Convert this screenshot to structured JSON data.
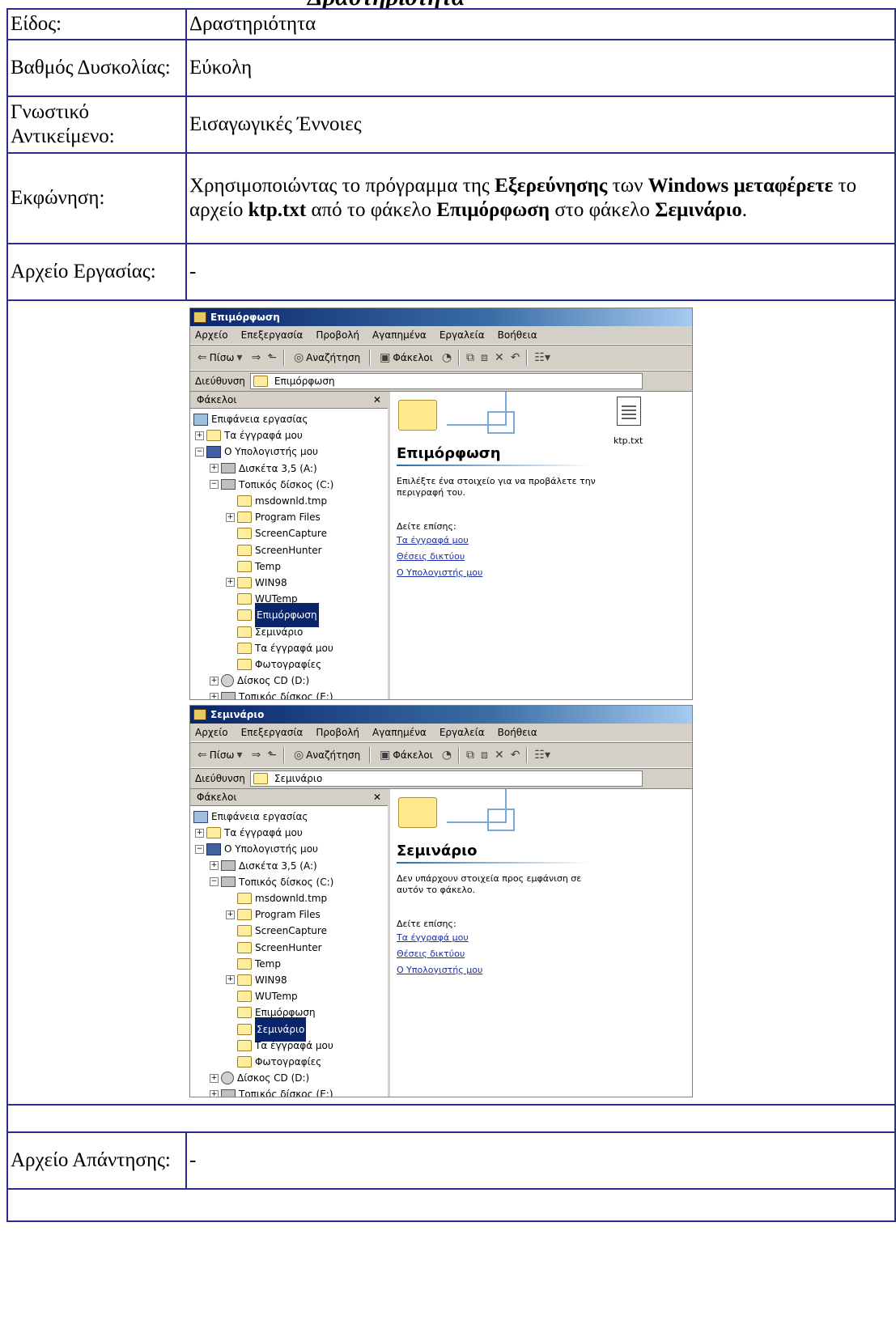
{
  "heading_cut": "Δραστηριότητα",
  "rows": [
    {
      "label": "Είδος:",
      "value": "Δραστηριότητα"
    },
    {
      "label": "Βαθμός Δυσκολίας:",
      "value": "Εύκολη"
    },
    {
      "label": "Γνωστικό Αντικείμενο:",
      "value": "Εισαγωγικές Έννοιες"
    }
  ],
  "task": {
    "label": "Εκφώνηση:",
    "p1": "Χρησιμοποιώντας το πρόγραμμα της ",
    "b1": "Εξερεύνησης",
    "p2": " των ",
    "b2": "Windows",
    "p3": " ",
    "b3": "μεταφέρετε",
    "p4": " το αρχείο ",
    "b4": "ktp.txt",
    "p5": " από το φάκελο ",
    "b5": "Επιμόρφωση",
    "p6": " στο φάκελο ",
    "b6": "Σεμινάριο",
    "p7": "."
  },
  "work_file": {
    "label": "Αρχείο Εργασίας:",
    "value": "-"
  },
  "answer_file": {
    "label": "Αρχείο Απάντησης:",
    "value": "-"
  },
  "windows": [
    {
      "title": "Επιμόρφωση",
      "menu": [
        "Αρχείο",
        "Επεξεργασία",
        "Προβολή",
        "Αγαπημένα",
        "Εργαλεία",
        "Βοήθεια"
      ],
      "back": "Πίσω",
      "search": "Αναζήτηση",
      "folders_btn": "Φάκελοι",
      "address_label": "Διεύθυνση",
      "address": "Επιμόρφωση",
      "pane_title": "Φάκελοι",
      "tree": [
        "Επιφάνεια εργασίας",
        "Τα έγγραφά μου",
        "Ο Υπολογιστής μου",
        "Δισκέτα 3,5 (A:)",
        "Τοπικός δίσκος (C:)",
        "msdownld.tmp",
        "Program Files",
        "ScreenCapture",
        "ScreenHunter",
        "Temp",
        "WIN98",
        "WUTemp",
        "Επιμόρφωση",
        "Σεμινάριο",
        "Τα έγγραφά μου",
        "Φωτογραφίες",
        "Δίσκος CD (D:)",
        "Τοπικός δίσκος (E:)"
      ],
      "panel_title": "Επιμόρφωση",
      "panel_desc": "Επιλέξτε ένα στοιχείο για να προβάλετε την περιγραφή του.",
      "see_also": "Δείτε επίσης:",
      "links": [
        "Τα έγγραφά μου",
        "Θέσεις δικτύου",
        "Ο Υπολογιστής μου"
      ],
      "file": "ktp.txt"
    },
    {
      "title": "Σεμινάριο",
      "menu": [
        "Αρχείο",
        "Επεξεργασία",
        "Προβολή",
        "Αγαπημένα",
        "Εργαλεία",
        "Βοήθεια"
      ],
      "back": "Πίσω",
      "search": "Αναζήτηση",
      "folders_btn": "Φάκελοι",
      "address_label": "Διεύθυνση",
      "address": "Σεμινάριο",
      "pane_title": "Φάκελοι",
      "tree": [
        "Επιφάνεια εργασίας",
        "Τα έγγραφά μου",
        "Ο Υπολογιστής μου",
        "Δισκέτα 3,5 (A:)",
        "Τοπικός δίσκος (C:)",
        "msdownld.tmp",
        "Program Files",
        "ScreenCapture",
        "ScreenHunter",
        "Temp",
        "WIN98",
        "WUTemp",
        "Επιμόρφωση",
        "Σεμινάριο",
        "Τα έγγραφά μου",
        "Φωτογραφίες",
        "Δίσκος CD (D:)",
        "Τοπικός δίσκος (E:)"
      ],
      "panel_title": "Σεμινάριο",
      "panel_desc": "Δεν υπάρχουν στοιχεία προς εμφάνιση σε αυτόν το φάκελο.",
      "see_also": "Δείτε επίσης:",
      "links": [
        "Τα έγγραφά μου",
        "Θέσεις δικτύου",
        "Ο Υπολογιστής μου"
      ]
    }
  ]
}
